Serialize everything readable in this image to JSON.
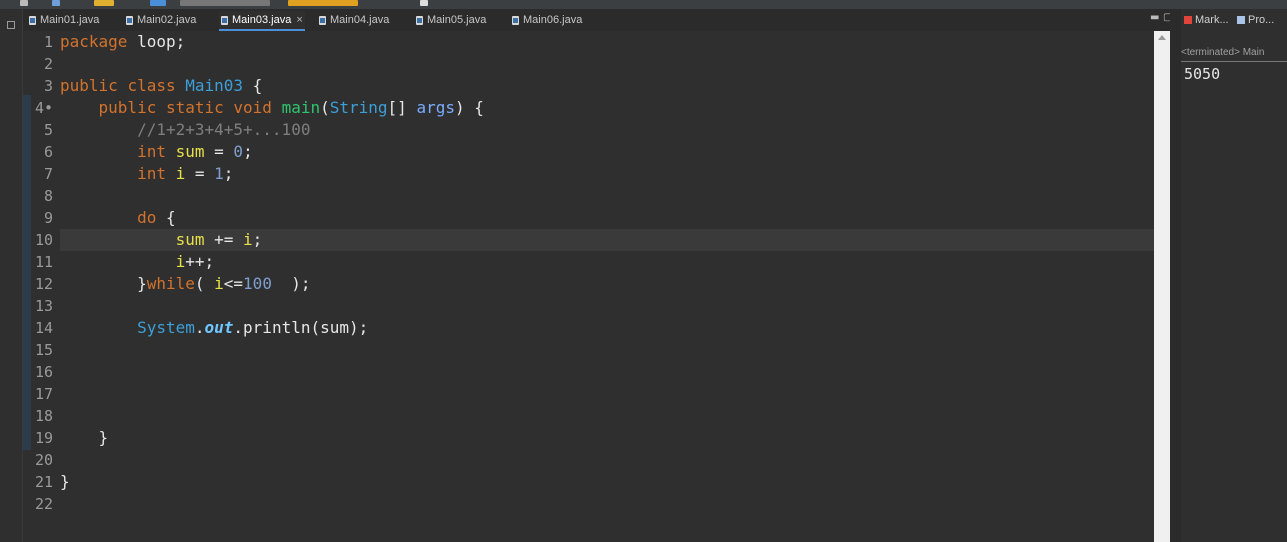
{
  "editor": {
    "tabs": [
      {
        "label": "Main01.java",
        "active": false
      },
      {
        "label": "Main02.java",
        "active": false
      },
      {
        "label": "Main03.java",
        "active": true
      },
      {
        "label": "Main04.java",
        "active": false
      },
      {
        "label": "Main05.java",
        "active": false
      },
      {
        "label": "Main06.java",
        "active": false
      }
    ],
    "close_glyph": "×",
    "current_line": 10,
    "lines": [
      {
        "n": "1",
        "tokens": [
          [
            "kw",
            "package"
          ],
          [
            "pln",
            " loop;"
          ]
        ]
      },
      {
        "n": "2",
        "tokens": []
      },
      {
        "n": "3",
        "tokens": [
          [
            "kw",
            "public"
          ],
          [
            "pln",
            " "
          ],
          [
            "kw",
            "class"
          ],
          [
            "pln",
            " "
          ],
          [
            "cls",
            "Main03"
          ],
          [
            "pln",
            " {"
          ]
        ]
      },
      {
        "n": "4•",
        "tokens": [
          [
            "pln",
            "    "
          ],
          [
            "kw",
            "public"
          ],
          [
            "pln",
            " "
          ],
          [
            "kw",
            "static"
          ],
          [
            "pln",
            " "
          ],
          [
            "kw",
            "void"
          ],
          [
            "pln",
            " "
          ],
          [
            "mth",
            "main"
          ],
          [
            "pln",
            "("
          ],
          [
            "cls",
            "String"
          ],
          [
            "pln",
            "[] "
          ],
          [
            "prm",
            "args"
          ],
          [
            "pln",
            ") {"
          ]
        ]
      },
      {
        "n": "5",
        "tokens": [
          [
            "pln",
            "        "
          ],
          [
            "cmt",
            "//1+2+3+4+5+...100"
          ]
        ]
      },
      {
        "n": "6",
        "tokens": [
          [
            "pln",
            "        "
          ],
          [
            "kw",
            "int"
          ],
          [
            "pln",
            " "
          ],
          [
            "var",
            "sum"
          ],
          [
            "pln",
            " = "
          ],
          [
            "num",
            "0"
          ],
          [
            "pln",
            ";"
          ]
        ]
      },
      {
        "n": "7",
        "tokens": [
          [
            "pln",
            "        "
          ],
          [
            "kw",
            "int"
          ],
          [
            "pln",
            " "
          ],
          [
            "var",
            "i"
          ],
          [
            "pln",
            " = "
          ],
          [
            "num",
            "1"
          ],
          [
            "pln",
            ";"
          ]
        ]
      },
      {
        "n": "8",
        "tokens": []
      },
      {
        "n": "9",
        "tokens": [
          [
            "pln",
            "        "
          ],
          [
            "kw",
            "do"
          ],
          [
            "pln",
            " {"
          ]
        ]
      },
      {
        "n": "10",
        "tokens": [
          [
            "pln",
            "            "
          ],
          [
            "var",
            "sum"
          ],
          [
            "pln",
            " += "
          ],
          [
            "var",
            "i"
          ],
          [
            "pln",
            ";"
          ]
        ]
      },
      {
        "n": "11",
        "tokens": [
          [
            "pln",
            "            "
          ],
          [
            "var",
            "i"
          ],
          [
            "pln",
            "++;"
          ]
        ]
      },
      {
        "n": "12",
        "tokens": [
          [
            "pln",
            "        }"
          ],
          [
            "kw",
            "while"
          ],
          [
            "pln",
            "( "
          ],
          [
            "var",
            "i"
          ],
          [
            "pln",
            "<="
          ],
          [
            "num",
            "100"
          ],
          [
            "pln",
            "  );"
          ]
        ]
      },
      {
        "n": "13",
        "tokens": []
      },
      {
        "n": "14",
        "tokens": [
          [
            "pln",
            "        "
          ],
          [
            "cls",
            "System"
          ],
          [
            "pln",
            "."
          ],
          [
            "fld",
            "out"
          ],
          [
            "pln",
            ".println(sum);"
          ]
        ]
      },
      {
        "n": "15",
        "tokens": []
      },
      {
        "n": "16",
        "tokens": []
      },
      {
        "n": "17",
        "tokens": []
      },
      {
        "n": "18",
        "tokens": []
      },
      {
        "n": "19",
        "tokens": [
          [
            "pln",
            "    }"
          ]
        ]
      },
      {
        "n": "20",
        "tokens": []
      },
      {
        "n": "21",
        "tokens": [
          [
            "pln",
            "}"
          ]
        ]
      },
      {
        "n": "22",
        "tokens": []
      }
    ]
  },
  "console": {
    "tabs": [
      {
        "label": "Mark...",
        "icon": "markers-icon",
        "color": "#e0443b"
      },
      {
        "label": "Pro...",
        "icon": "properties-icon",
        "color": "#a8c4e6"
      }
    ],
    "header": "<terminated> Main",
    "output": "5050"
  },
  "colors": {
    "keyword": "#d2732d",
    "class": "#3d9fd8",
    "method": "#2fc46e",
    "variable": "#e8e048",
    "number": "#7f9ecf",
    "comment": "#7e7e7e",
    "background": "#2f2f2f",
    "active_tab_underline": "#4a90d9"
  }
}
